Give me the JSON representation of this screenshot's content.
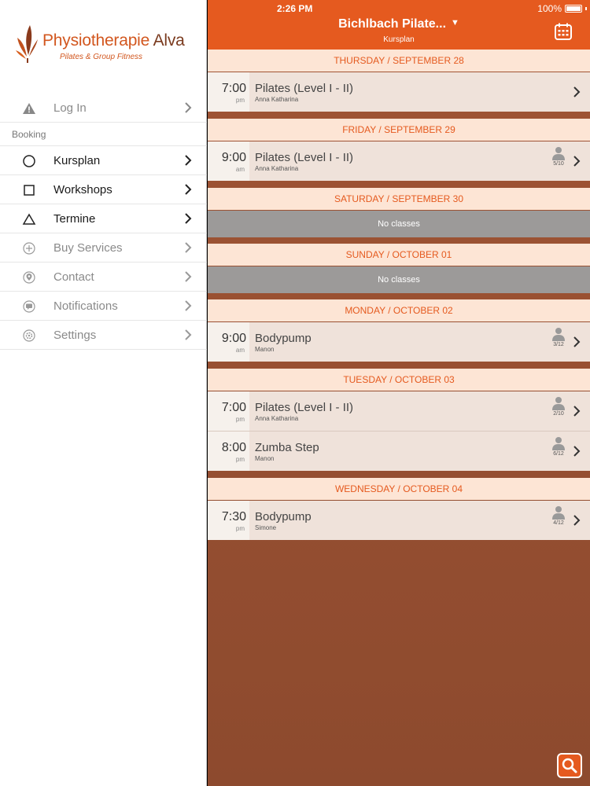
{
  "status_bar": {
    "time": "2:26 PM",
    "battery": "100%"
  },
  "brand": {
    "title_main": "Physiotherapie",
    "title_accent": "Alva",
    "subtitle": "Pilates & Group Fitness"
  },
  "sidebar": {
    "login": {
      "label": "Log In",
      "icon": "warning-triangle-icon"
    },
    "section_label": "Booking",
    "items": [
      {
        "label": "Kursplan",
        "icon": "circle-icon",
        "active": true
      },
      {
        "label": "Workshops",
        "icon": "square-icon",
        "active": true
      },
      {
        "label": "Termine",
        "icon": "triangle-icon",
        "active": true
      },
      {
        "label": "Buy Services",
        "icon": "plus-circle-icon",
        "active": false
      },
      {
        "label": "Contact",
        "icon": "location-pin-icon",
        "active": false
      },
      {
        "label": "Notifications",
        "icon": "chat-bubble-icon",
        "active": false
      },
      {
        "label": "Settings",
        "icon": "gear-icon",
        "active": false
      }
    ]
  },
  "header": {
    "title": "Bichlbach Pilate...",
    "caret": "▼",
    "subtitle": "Kursplan",
    "calendar_icon": "calendar-icon"
  },
  "schedule": {
    "thursday": {
      "header": "THURSDAY / SEPTEMBER 28",
      "classes": [
        {
          "time": "7:00",
          "ampm": "pm",
          "name": "Pilates (Level I - II)",
          "trainer": "Anna Katharina",
          "capacity": ""
        }
      ]
    },
    "friday": {
      "header": "FRIDAY / SEPTEMBER 29",
      "classes": [
        {
          "time": "9:00",
          "ampm": "am",
          "name": "Pilates (Level I - II)",
          "trainer": "Anna Katharina",
          "capacity": "5/10"
        }
      ]
    },
    "saturday": {
      "header": "SATURDAY / SEPTEMBER 30",
      "empty": "No classes"
    },
    "sunday": {
      "header": "SUNDAY / OCTOBER 01",
      "empty": "No classes"
    },
    "monday": {
      "header": "MONDAY / OCTOBER 02",
      "classes": [
        {
          "time": "9:00",
          "ampm": "am",
          "name": "Bodypump",
          "trainer": "Manon",
          "capacity": "3/12"
        }
      ]
    },
    "tuesday": {
      "header": "TUESDAY / OCTOBER 03",
      "classes": [
        {
          "time": "7:00",
          "ampm": "pm",
          "name": "Pilates (Level I - II)",
          "trainer": "Anna Katharina",
          "capacity": "2/10"
        },
        {
          "time": "8:00",
          "ampm": "pm",
          "name": "Zumba Step",
          "trainer": "Manon",
          "capacity": "6/12"
        }
      ]
    },
    "wednesday": {
      "header": "WEDNESDAY / OCTOBER 04",
      "classes": [
        {
          "time": "7:30",
          "ampm": "pm",
          "name": "Bodypump",
          "trainer": "Simone",
          "capacity": "4/12"
        }
      ]
    }
  },
  "search_icon": "search-icon",
  "colors": {
    "accent": "#e55a1f",
    "day_header_bg": "#fde5d5",
    "pane_bg": "#9a5031",
    "no_classes_bg": "#9c9a99"
  }
}
